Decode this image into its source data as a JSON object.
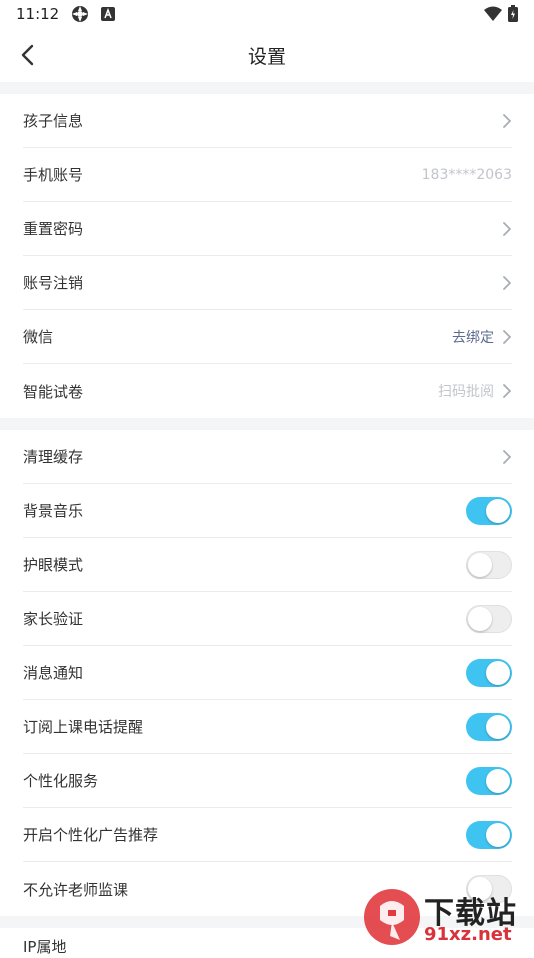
{
  "status_bar": {
    "time": "11:12"
  },
  "header": {
    "title": "设置"
  },
  "section1": [
    {
      "label": "孩子信息",
      "value": "",
      "chevron": true
    },
    {
      "label": "手机账号",
      "value": "183****2063",
      "chevron": false
    },
    {
      "label": "重置密码",
      "value": "",
      "chevron": true
    },
    {
      "label": "账号注销",
      "value": "",
      "chevron": true
    },
    {
      "label": "微信",
      "value": "去绑定",
      "chevron": true
    },
    {
      "label": "智能试卷",
      "value": "扫码批阅",
      "chevron": true
    }
  ],
  "section2": [
    {
      "label": "清理缓存",
      "chevron": true
    },
    {
      "label": "背景音乐",
      "toggle": true
    },
    {
      "label": "护眼模式",
      "toggle": false
    },
    {
      "label": "家长验证",
      "toggle": false
    },
    {
      "label": "消息通知",
      "toggle": true
    },
    {
      "label": "订阅上课电话提醒",
      "toggle": true
    },
    {
      "label": "个性化服务",
      "toggle": true
    },
    {
      "label": "开启个性化广告推荐",
      "toggle": true
    },
    {
      "label": "不允许老师监课",
      "toggle": false
    }
  ],
  "section3": [
    {
      "label": "IP属地"
    }
  ],
  "watermark": {
    "text1": "下载站",
    "text2": "91xz.net"
  },
  "colors": {
    "accent": "#3fc3f0",
    "link": "#5b6b8f",
    "divider": "#f4f5f7"
  }
}
